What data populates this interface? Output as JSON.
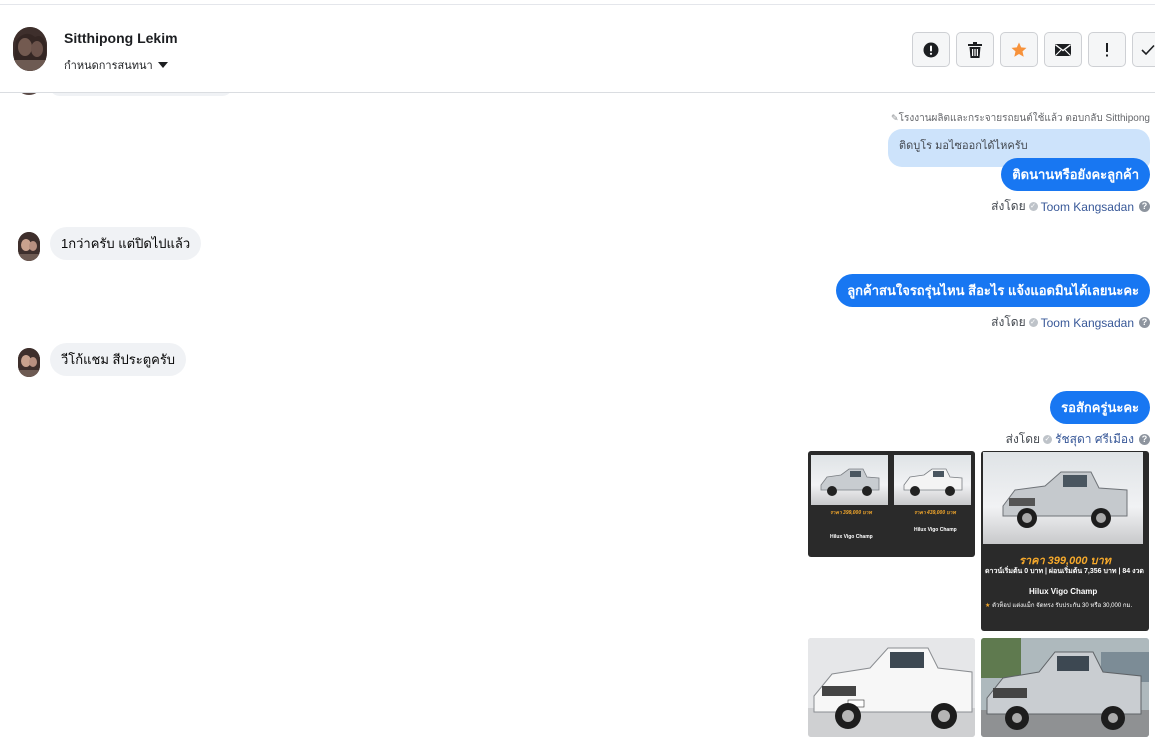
{
  "header": {
    "contact_name": "Sitthipong Lekim",
    "assign_label": "กำหนดการสนทนา"
  },
  "actions": [
    {
      "icon": "alert-circle-icon",
      "name": "spam-button"
    },
    {
      "icon": "trash-icon",
      "name": "delete-button"
    },
    {
      "icon": "star-icon",
      "name": "star-button",
      "color": "#f7923b"
    },
    {
      "icon": "envelope-icon",
      "name": "mark-unread-button"
    },
    {
      "icon": "exclamation-icon",
      "name": "follow-up-button"
    },
    {
      "icon": "check-icon",
      "name": "done-button"
    }
  ],
  "messages": {
    "reply_note": "โรงงานผลิตและกระจายรถยนต์ใช้แล้ว ตอบกลับ Sitthipong",
    "quoted_text": "ติดบูโร มอไซออกได้ไหครับ",
    "out1": "ติดนานหรือยังคะลูกค้า",
    "sent_by_label": "ส่งโดย",
    "sender1": "Toom Kangsadan",
    "in1": "1กว่าครับ  แต่ปิดไปแล้ว",
    "out2": "ลูกค้าสนใจรถรุ่นไหน สีอะไร แจ้งแอดมินได้เลยนะคะ",
    "sender2": "Toom Kangsadan",
    "in2": "วีโก้แชม  สีประตูครับ",
    "out3": "รอสักครู่นะคะ",
    "sender3": "รัชสุดา ศรีเมือง"
  },
  "cards": {
    "price_main": "ราคา 399,000 บาท",
    "down_line": "ดาวน์เริ่มต้น 0 บาท | ผ่อนเริ่มต้น 7,356 บาท | 84 งวด",
    "down_highlight": "7,356",
    "model": "Hilux Vigo Champ",
    "promo": "ตัวท็อป แต่งแม็ก จัดทรง รับประกัน 30 หรือ 30,000 กม.",
    "price_a1": "ราคา 399,000 บาท",
    "price_a2": "ราคา 439,000 บาท",
    "brand_color": "#f6a92b"
  },
  "colors": {
    "accent": "#1877f2",
    "in_bubble": "#f0f2f5",
    "quoted_bg": "#cde3fb"
  }
}
